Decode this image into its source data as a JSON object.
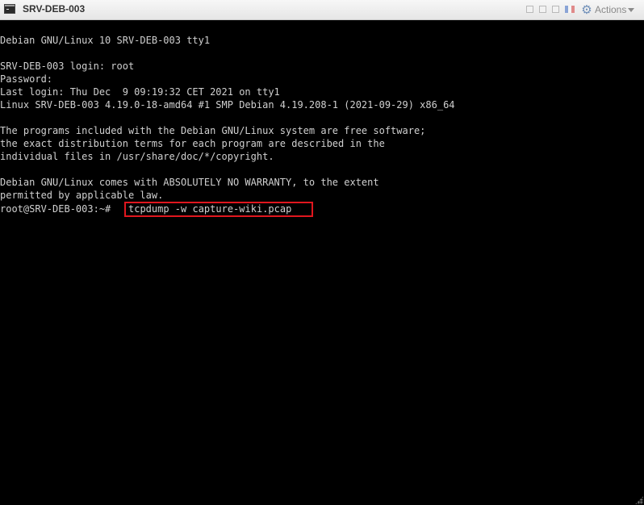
{
  "window": {
    "title": "SRV-DEB-003",
    "actions_label": "Actions"
  },
  "console": {
    "lines": [
      "",
      "Debian GNU/Linux 10 SRV-DEB-003 tty1",
      "",
      "SRV-DEB-003 login: root",
      "Password:",
      "Last login: Thu Dec  9 09:19:32 CET 2021 on tty1",
      "Linux SRV-DEB-003 4.19.0-18-amd64 #1 SMP Debian 4.19.208-1 (2021-09-29) x86_64",
      "",
      "The programs included with the Debian GNU/Linux system are free software;",
      "the exact distribution terms for each program are described in the",
      "individual files in /usr/share/doc/*/copyright.",
      "",
      "Debian GNU/Linux comes with ABSOLUTELY NO WARRANTY, to the extent",
      "permitted by applicable law."
    ],
    "prompt": "root@SRV-DEB-003:~#",
    "command": "tcpdump -w capture-wiki.pcap"
  },
  "colors": {
    "highlight": "#e0161e",
    "terminal_bg": "#000000",
    "terminal_fg": "#d0d0d0"
  }
}
